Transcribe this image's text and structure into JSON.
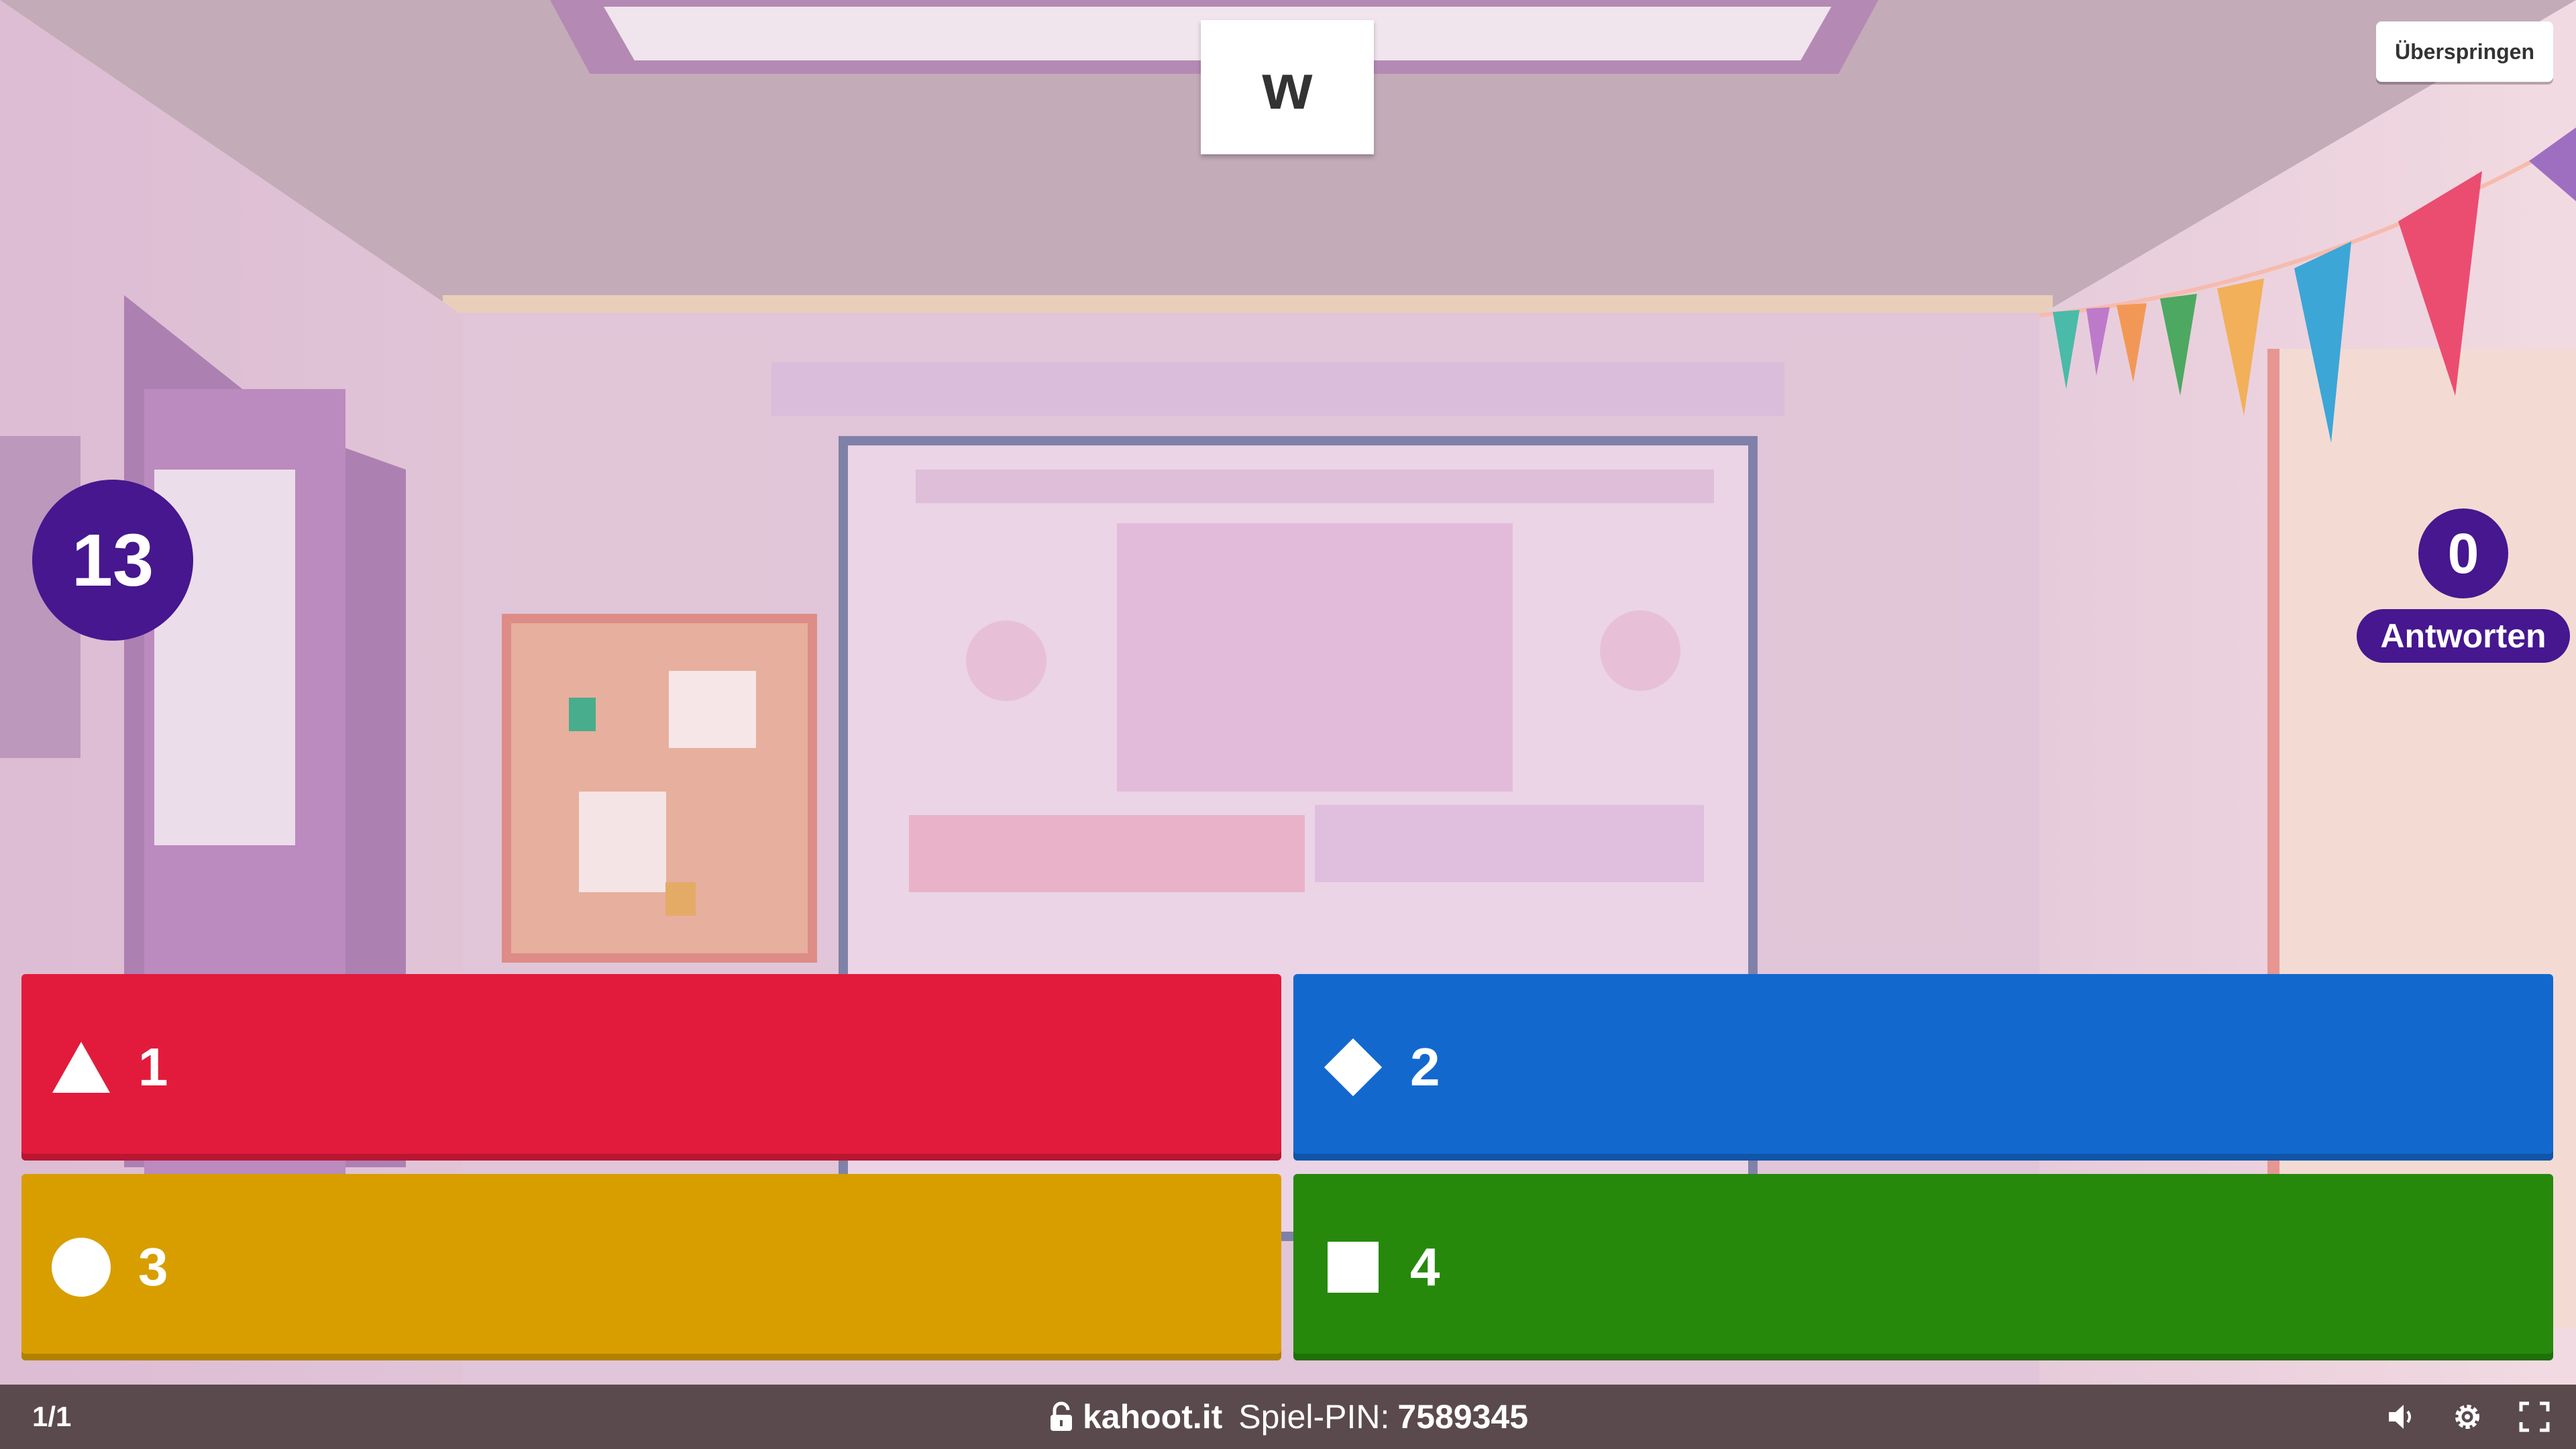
{
  "question": {
    "title": "w"
  },
  "controls": {
    "skip_label": "Überspringen"
  },
  "timer": {
    "value": "13"
  },
  "answers_counter": {
    "count": "0",
    "label": "Antworten"
  },
  "answers": [
    {
      "label": "1",
      "shape": "triangle-icon",
      "color": "#e21b3c"
    },
    {
      "label": "2",
      "shape": "diamond-icon",
      "color": "#1368ce"
    },
    {
      "label": "3",
      "shape": "circle-icon",
      "color": "#d89e00"
    },
    {
      "label": "4",
      "shape": "square-icon",
      "color": "#26890c"
    }
  ],
  "footer": {
    "page": "1/1",
    "site": "kahoot.it",
    "pin_label": "Spiel-PIN:",
    "pin": "7589345",
    "icons": [
      "lock-icon",
      "volume-icon",
      "gear-icon",
      "fullscreen-icon"
    ]
  },
  "colors": {
    "brand_purple": "#46178f",
    "footer_bg": "#5a4a4e"
  }
}
